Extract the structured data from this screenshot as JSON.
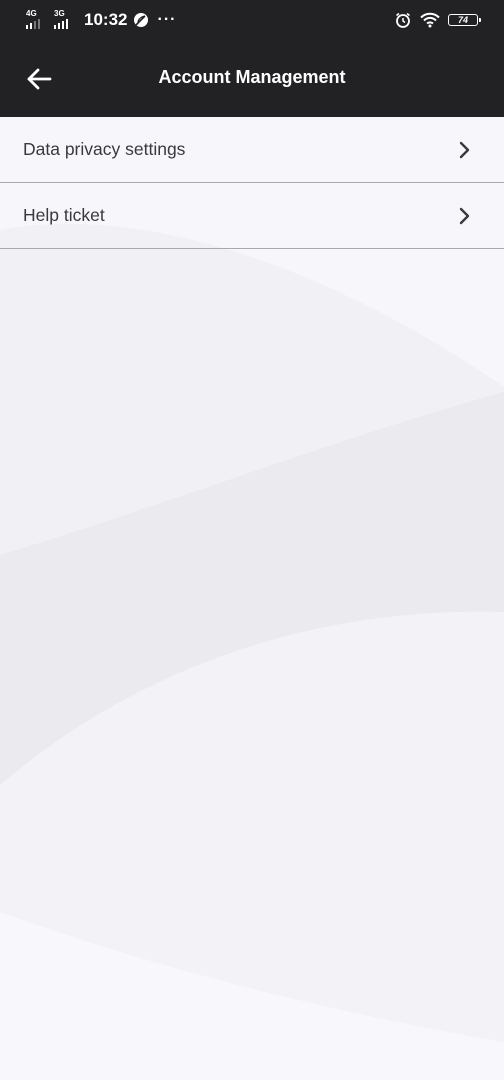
{
  "status_bar": {
    "net1": "4G",
    "net2": "3G",
    "time": "10:32",
    "more": "···",
    "battery": "74",
    "icons": [
      "signal-icon",
      "leaf-icon",
      "alarm-icon",
      "wifi-icon",
      "battery-icon"
    ]
  },
  "header": {
    "title": "Account Management",
    "back_icon": "arrow-left-icon"
  },
  "menu": {
    "items": [
      {
        "label": "Data privacy settings",
        "icon": "chevron-right-icon"
      },
      {
        "label": "Help ticket",
        "icon": "chevron-right-icon"
      }
    ]
  },
  "colors": {
    "header_bg": "#222225",
    "page_bg": "#f7f6fa",
    "divider": "#a9a9ad",
    "text": "#3a3a3c"
  }
}
